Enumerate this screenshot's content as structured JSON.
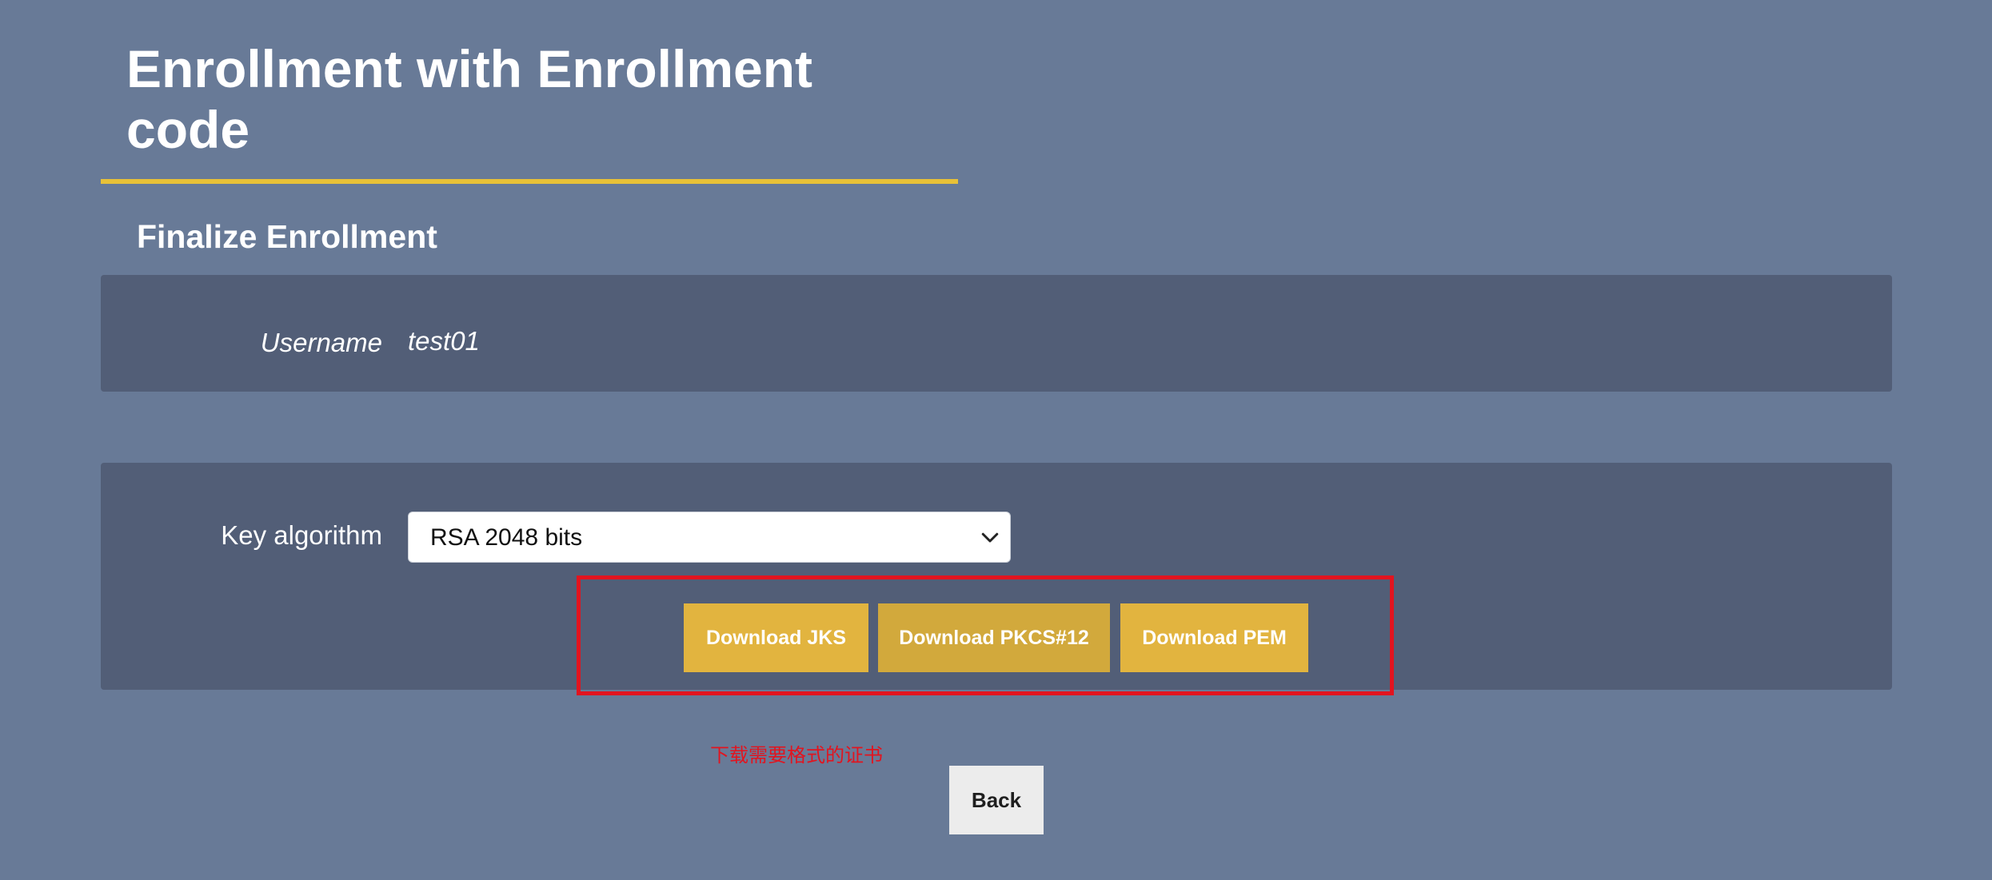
{
  "page": {
    "title": "Enrollment with Enrollment code",
    "section_title": "Finalize Enrollment"
  },
  "user_panel": {
    "username_label": "Username",
    "username_value": "test01"
  },
  "key_panel": {
    "key_algorithm_label": "Key algorithm",
    "key_algorithm_selected": "RSA 2048 bits",
    "select_icon": "chevron-down-icon"
  },
  "actions": {
    "download_jks": "Download JKS",
    "download_pkcs12": "Download PKCS#12",
    "download_pem": "Download PEM",
    "back": "Back"
  },
  "annotation": {
    "text": "下载需要格式的证书",
    "highlight_color": "#e2141f"
  },
  "colors": {
    "background": "#687a97",
    "panel": "#525e77",
    "accent": "#e8c137",
    "button": "#e2b43f"
  }
}
